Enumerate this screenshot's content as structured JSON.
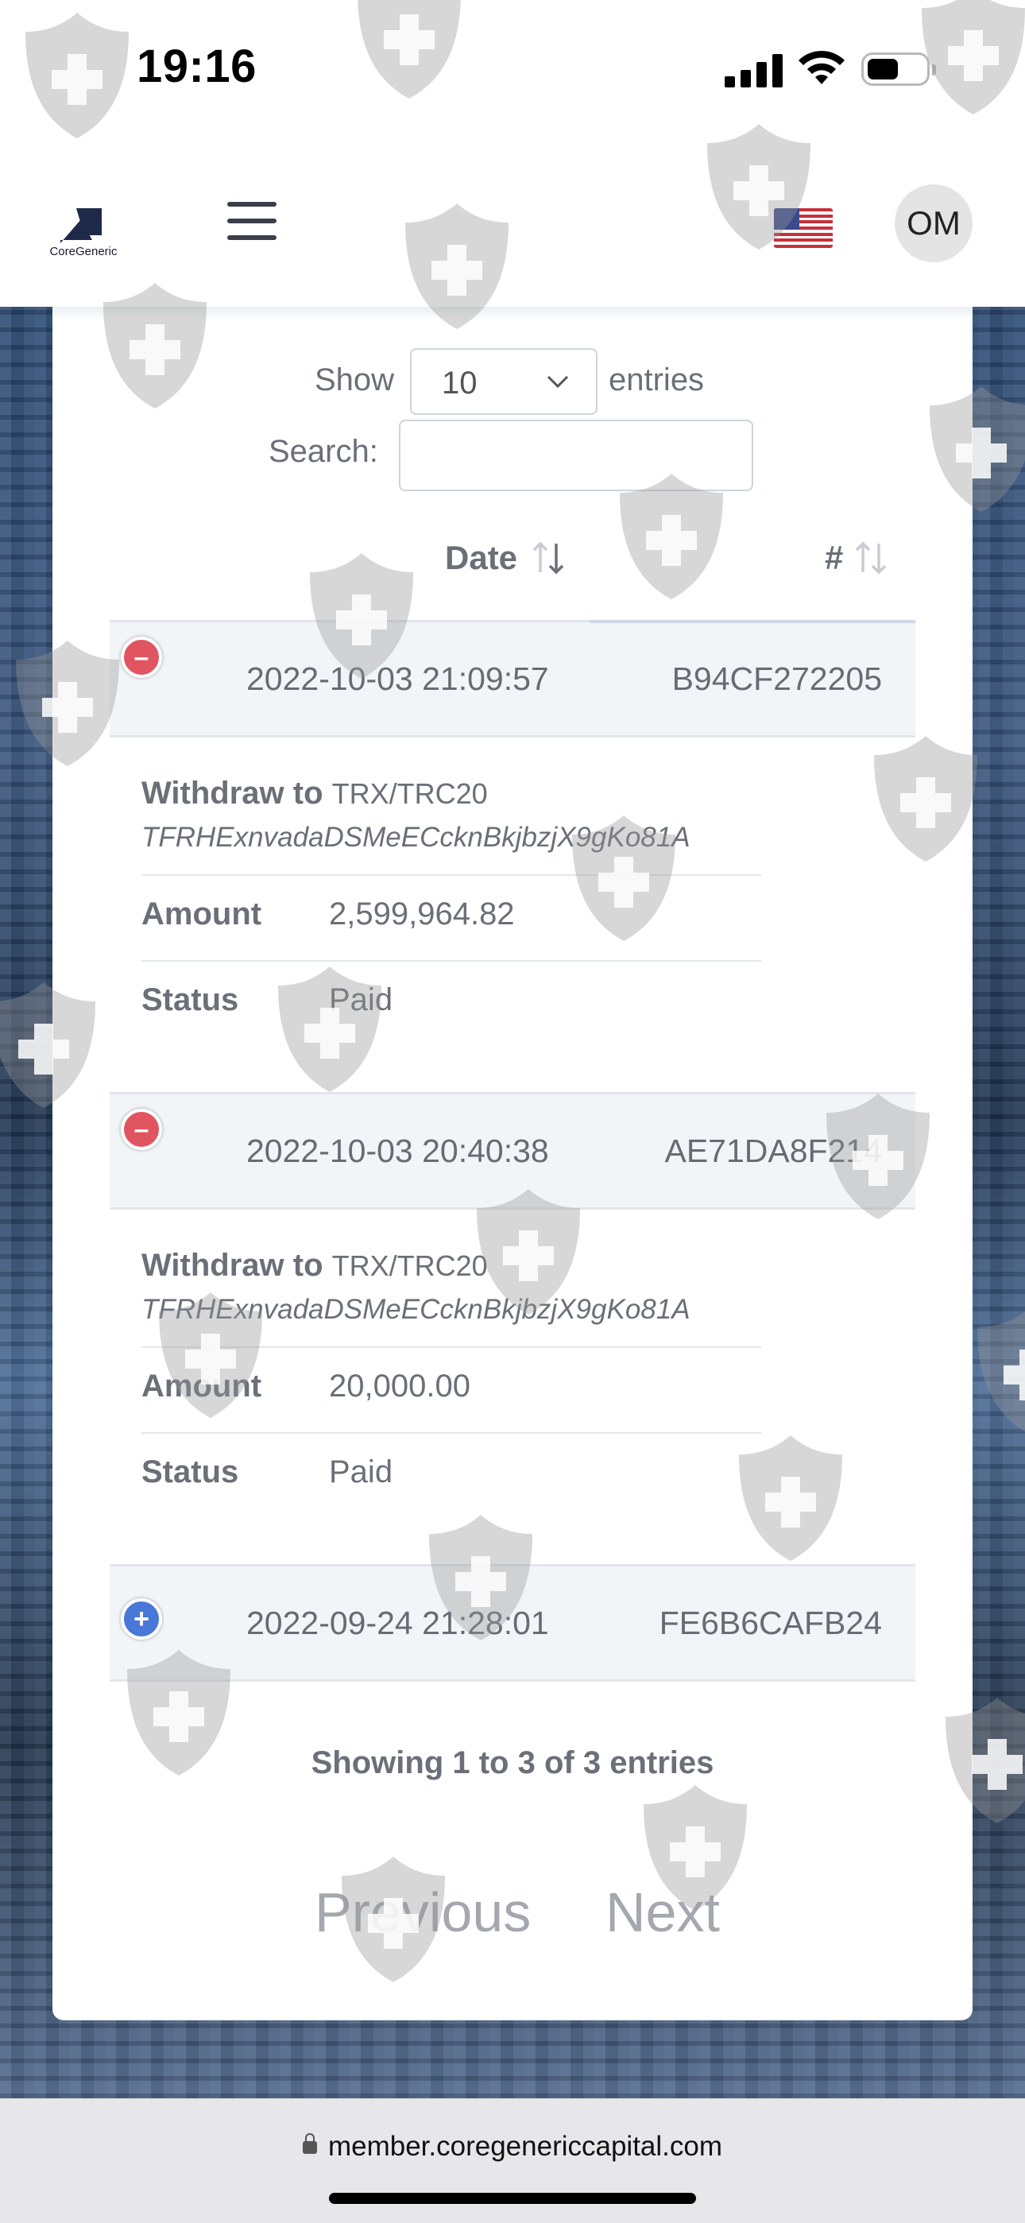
{
  "status_bar": {
    "time": "19:16"
  },
  "header": {
    "brand": "CoreGeneric",
    "avatar_initials": "OM",
    "flag_icon": "us-flag-icon",
    "menu_icon": "hamburger-menu-icon"
  },
  "table": {
    "length": {
      "show_label": "Show",
      "selected": "10",
      "entries_label": "entries"
    },
    "search": {
      "label": "Search:",
      "value": ""
    },
    "columns": [
      {
        "label": "Date"
      },
      {
        "label": "#"
      }
    ],
    "rows": [
      {
        "date": "2022-10-03 21:09:57",
        "id": "B94CF272205",
        "expanded": true,
        "details": {
          "withdraw_label": "Withdraw to",
          "network": "TRX/TRC20",
          "address": "TFRHExnvadaDSMeECcknBkjbzjX9gKo81A",
          "amount_label": "Amount",
          "amount": "2,599,964.82",
          "status_label": "Status",
          "status": "Paid"
        }
      },
      {
        "date": "2022-10-03 20:40:38",
        "id": "AE71DA8F214",
        "expanded": true,
        "details": {
          "withdraw_label": "Withdraw to",
          "network": "TRX/TRC20",
          "address": "TFRHExnvadaDSMeECcknBkjbzjX9gKo81A",
          "amount_label": "Amount",
          "amount": "20,000.00",
          "status_label": "Status",
          "status": "Paid"
        }
      },
      {
        "date": "2022-09-24 21:28:01",
        "id": "FE6B6CAFB24",
        "expanded": false
      }
    ],
    "info": "Showing 1 to 3 of 3 entries",
    "pagination": {
      "previous": "Previous",
      "next": "Next"
    }
  },
  "browser": {
    "url": "member.coregenericcapital.com"
  },
  "colors": {
    "collapse": "#e05560",
    "expand": "#4a78d8",
    "text": "#6a6f78"
  }
}
